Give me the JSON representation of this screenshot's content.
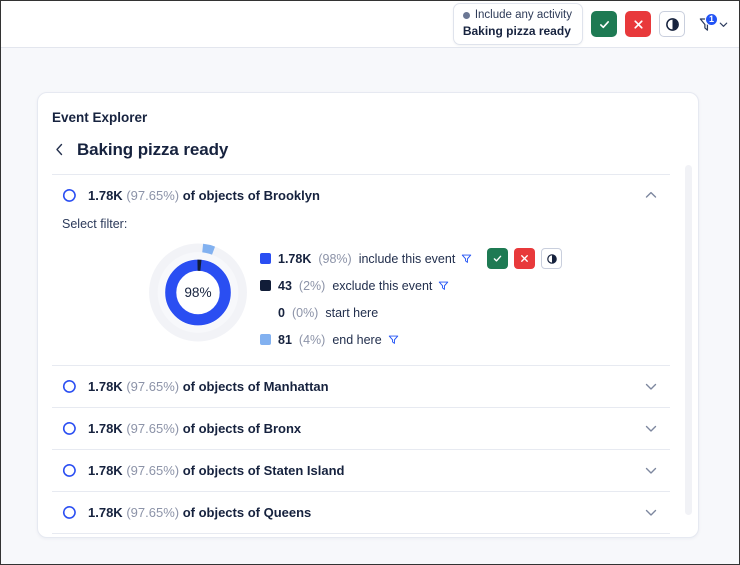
{
  "topbar": {
    "activity_chip": {
      "status_label": "Include any activity",
      "event_name": "Baking pizza ready"
    },
    "approve_label": "✓",
    "reject_label": "✕",
    "contrast_label": "◐",
    "filter_badge_count": "1"
  },
  "card": {
    "explorer_title": "Event Explorer",
    "event_title": "Baking pizza ready",
    "back_label": "‹"
  },
  "colors": {
    "include": "#2a4ef2",
    "exclude": "#111d38",
    "end_here": "#82b1f0",
    "ring_track": "#f1f2f6",
    "accent": "#2253f5",
    "green": "#1e7a53",
    "red": "#e8393b"
  },
  "expanded_panel": {
    "select_filter_label": "Select filter:",
    "donut": {
      "center_label": "98%",
      "inner_include_pct": 98,
      "inner_exclude_pct": 2,
      "outer_end_here_pct": 4
    },
    "legend": [
      {
        "count": "1.78K",
        "pct": "(98%)",
        "text": "include this event",
        "color": "#2a4ef2",
        "has_funnel": true,
        "funnel_dark": false,
        "has_actions": true
      },
      {
        "count": "43",
        "pct": "(2%)",
        "text": "exclude this event",
        "color": "#111d38",
        "has_funnel": true,
        "funnel_dark": false,
        "has_actions": false
      },
      {
        "count": "0",
        "pct": "(0%)",
        "text": "start here",
        "color": "transparent",
        "has_funnel": false,
        "funnel_dark": false,
        "has_actions": false
      },
      {
        "count": "81",
        "pct": "(4%)",
        "text": "end here",
        "color": "#82b1f0",
        "has_funnel": true,
        "funnel_dark": false,
        "has_actions": false
      }
    ]
  },
  "rows": [
    {
      "count": "1.78K",
      "pct": "(97.65%)",
      "text": "of objects of Brooklyn",
      "expanded": true
    },
    {
      "count": "1.78K",
      "pct": "(97.65%)",
      "text": "of objects of Manhattan",
      "expanded": false
    },
    {
      "count": "1.78K",
      "pct": "(97.65%)",
      "text": "of objects of Bronx",
      "expanded": false
    },
    {
      "count": "1.78K",
      "pct": "(97.65%)",
      "text": "of objects of Staten Island",
      "expanded": false
    },
    {
      "count": "1.78K",
      "pct": "(97.65%)",
      "text": "of objects of Queens",
      "expanded": false
    }
  ]
}
